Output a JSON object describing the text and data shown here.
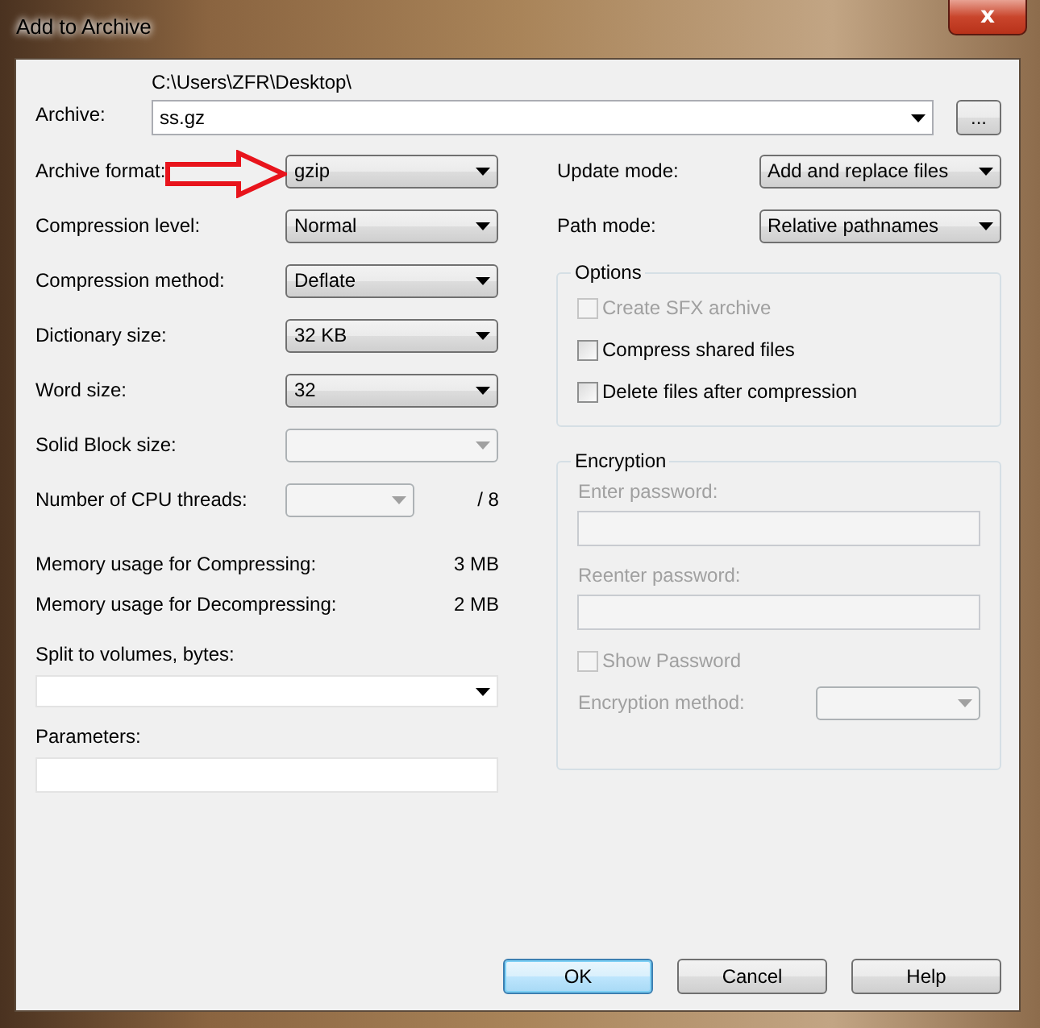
{
  "window": {
    "title": "Add to Archive",
    "close": "x"
  },
  "archive": {
    "label": "Archive:",
    "folder": "C:\\Users\\ZFR\\Desktop\\",
    "value": "ss.gz",
    "browse": "..."
  },
  "left_rows": [
    {
      "kind": "combo",
      "label": "Archive format:",
      "value": "gzip",
      "disabled": false,
      "highlighted": true
    },
    {
      "kind": "combo",
      "label": "Compression level:",
      "value": "Normal",
      "disabled": false
    },
    {
      "kind": "combo",
      "label": "Compression method:",
      "value": "Deflate",
      "disabled": false
    },
    {
      "kind": "combo",
      "label": "Dictionary size:",
      "value": "32 KB",
      "disabled": false
    },
    {
      "kind": "combo",
      "label": "Word size:",
      "value": "32",
      "disabled": false
    },
    {
      "kind": "combo",
      "label": "Solid Block size:",
      "disabled": true
    },
    {
      "kind": "threads",
      "label": "Number of CPU threads:",
      "disabled": true,
      "suffix": "/ 8"
    }
  ],
  "memory": [
    {
      "label": "Memory usage for Compressing:",
      "value": "3 MB"
    },
    {
      "label": "Memory usage for Decompressing:",
      "value": "2 MB"
    }
  ],
  "split": {
    "label": "Split to volumes, bytes:"
  },
  "parameters": {
    "label": "Parameters:"
  },
  "right_rows": [
    {
      "label": "Update mode:",
      "value": "Add and replace files",
      "disabled": false
    },
    {
      "label": "Path mode:",
      "value": "Relative pathnames",
      "disabled": false
    }
  ],
  "options": {
    "title": "Options",
    "items": [
      {
        "label": "Create SFX archive",
        "checked": false,
        "disabled": true
      },
      {
        "label": "Compress shared files",
        "checked": false,
        "disabled": false
      },
      {
        "label": "Delete files after compression",
        "checked": false,
        "disabled": false
      }
    ]
  },
  "encryption": {
    "title": "Encryption",
    "disabled": true,
    "fields": [
      {
        "label": "Enter password:"
      },
      {
        "label": "Reenter password:"
      }
    ],
    "show_password": {
      "label": "Show Password",
      "checked": false
    },
    "method": {
      "label": "Encryption method:"
    }
  },
  "buttons": [
    {
      "label": "OK",
      "default": true
    },
    {
      "label": "Cancel",
      "default": false
    },
    {
      "label": "Help",
      "default": false
    }
  ]
}
